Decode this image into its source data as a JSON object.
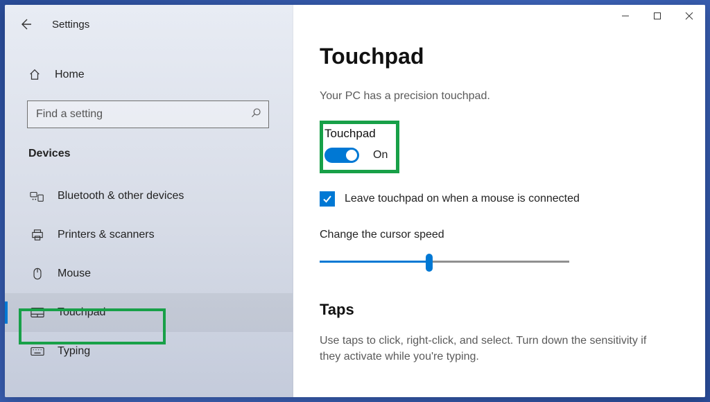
{
  "app": {
    "title": "Settings"
  },
  "home": {
    "label": "Home"
  },
  "search": {
    "placeholder": "Find a setting"
  },
  "category": "Devices",
  "nav": {
    "items": [
      {
        "id": "bluetooth",
        "label": "Bluetooth & other devices"
      },
      {
        "id": "printers",
        "label": "Printers & scanners"
      },
      {
        "id": "mouse",
        "label": "Mouse"
      },
      {
        "id": "touchpad",
        "label": "Touchpad",
        "selected": true
      },
      {
        "id": "typing",
        "label": "Typing"
      }
    ]
  },
  "main": {
    "title": "Touchpad",
    "subtitle": "Your PC has a precision touchpad.",
    "toggle": {
      "label": "Touchpad",
      "state_text": "On",
      "on": true
    },
    "checkbox": {
      "checked": true,
      "label": "Leave touchpad on when a mouse is connected"
    },
    "slider": {
      "label": "Change the cursor speed",
      "value_pct": 44
    },
    "taps": {
      "heading": "Taps",
      "desc": "Use taps to click, right-click, and select. Turn down the sensitivity if they activate while you're typing."
    }
  },
  "colors": {
    "accent": "#0078d4",
    "highlight": "#18a048"
  }
}
